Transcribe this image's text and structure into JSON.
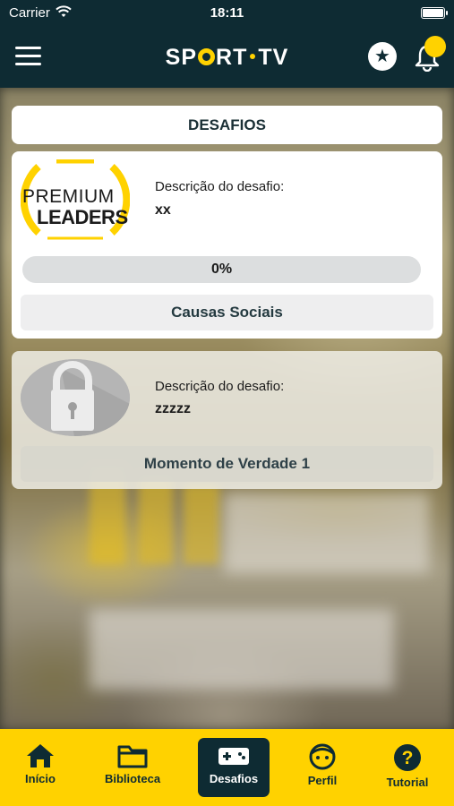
{
  "status_bar": {
    "carrier": "Carrier",
    "time": "18:11"
  },
  "nav": {
    "logo_left": "SP",
    "logo_mid": "RT",
    "logo_right": "TV"
  },
  "page": {
    "title": "DESAFIOS"
  },
  "challenges": [
    {
      "badge_line1": "PREMIUM",
      "badge_line2": "LEADERS",
      "description_label": "Descrição do desafio:",
      "description_value": "xx",
      "progress": 0,
      "progress_label": "0%",
      "category": "Causas Sociais",
      "locked": false
    },
    {
      "description_label": "Descrição do desafio:",
      "description_value": "zzzzz",
      "category": "Momento de Verdade 1",
      "locked": true
    }
  ],
  "tabs": [
    {
      "label": "Início",
      "icon": "home-icon"
    },
    {
      "label": "Biblioteca",
      "icon": "folder-icon"
    },
    {
      "label": "Desafios",
      "icon": "gamepad-icon",
      "active": true
    },
    {
      "label": "Perfil",
      "icon": "face-icon"
    },
    {
      "label": "Tutorial",
      "icon": "help-icon"
    }
  ],
  "colors": {
    "navy": "#0e2b33",
    "yellow": "#ffd200"
  }
}
